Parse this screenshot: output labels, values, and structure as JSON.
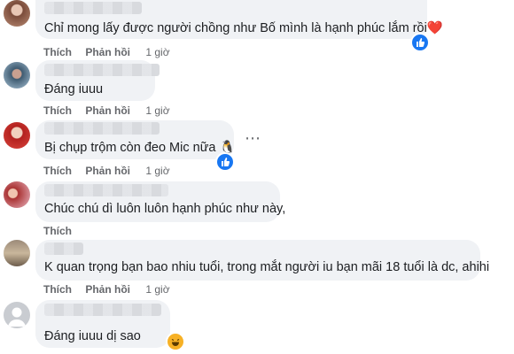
{
  "comments": [
    {
      "text": "Chỉ mong lấy được người chồng như Bố mình là hạnh phúc lắm rồi❤️",
      "time": "1 giờ"
    },
    {
      "text": "Đáng iuuu",
      "time": "1 giờ"
    },
    {
      "text": "Bị chụp trộm còn đeo Mic nữa 🐧",
      "time": "1 giờ"
    },
    {
      "text": "Chúc chú dì luôn luôn hạnh phúc như này,",
      "time": ""
    },
    {
      "text": "K quan trọng bạn bao nhiu tuổi, trong mắt người iu bạn mãi 18 tuổi là dc, ahihi",
      "time": "1 giờ"
    },
    {
      "text": "Đáng iuuu dị sao",
      "time": ""
    }
  ],
  "labels": {
    "like": "Thích",
    "reply": "Phản hồi"
  },
  "icons": {
    "reaction_like": "like-icon",
    "reaction_haha": "haha-icon",
    "more": "more-options-icon"
  },
  "colors": {
    "bubble": "#f0f2f5",
    "action": "#65676b",
    "like": "#1877f2",
    "haha": "#f7b125"
  }
}
